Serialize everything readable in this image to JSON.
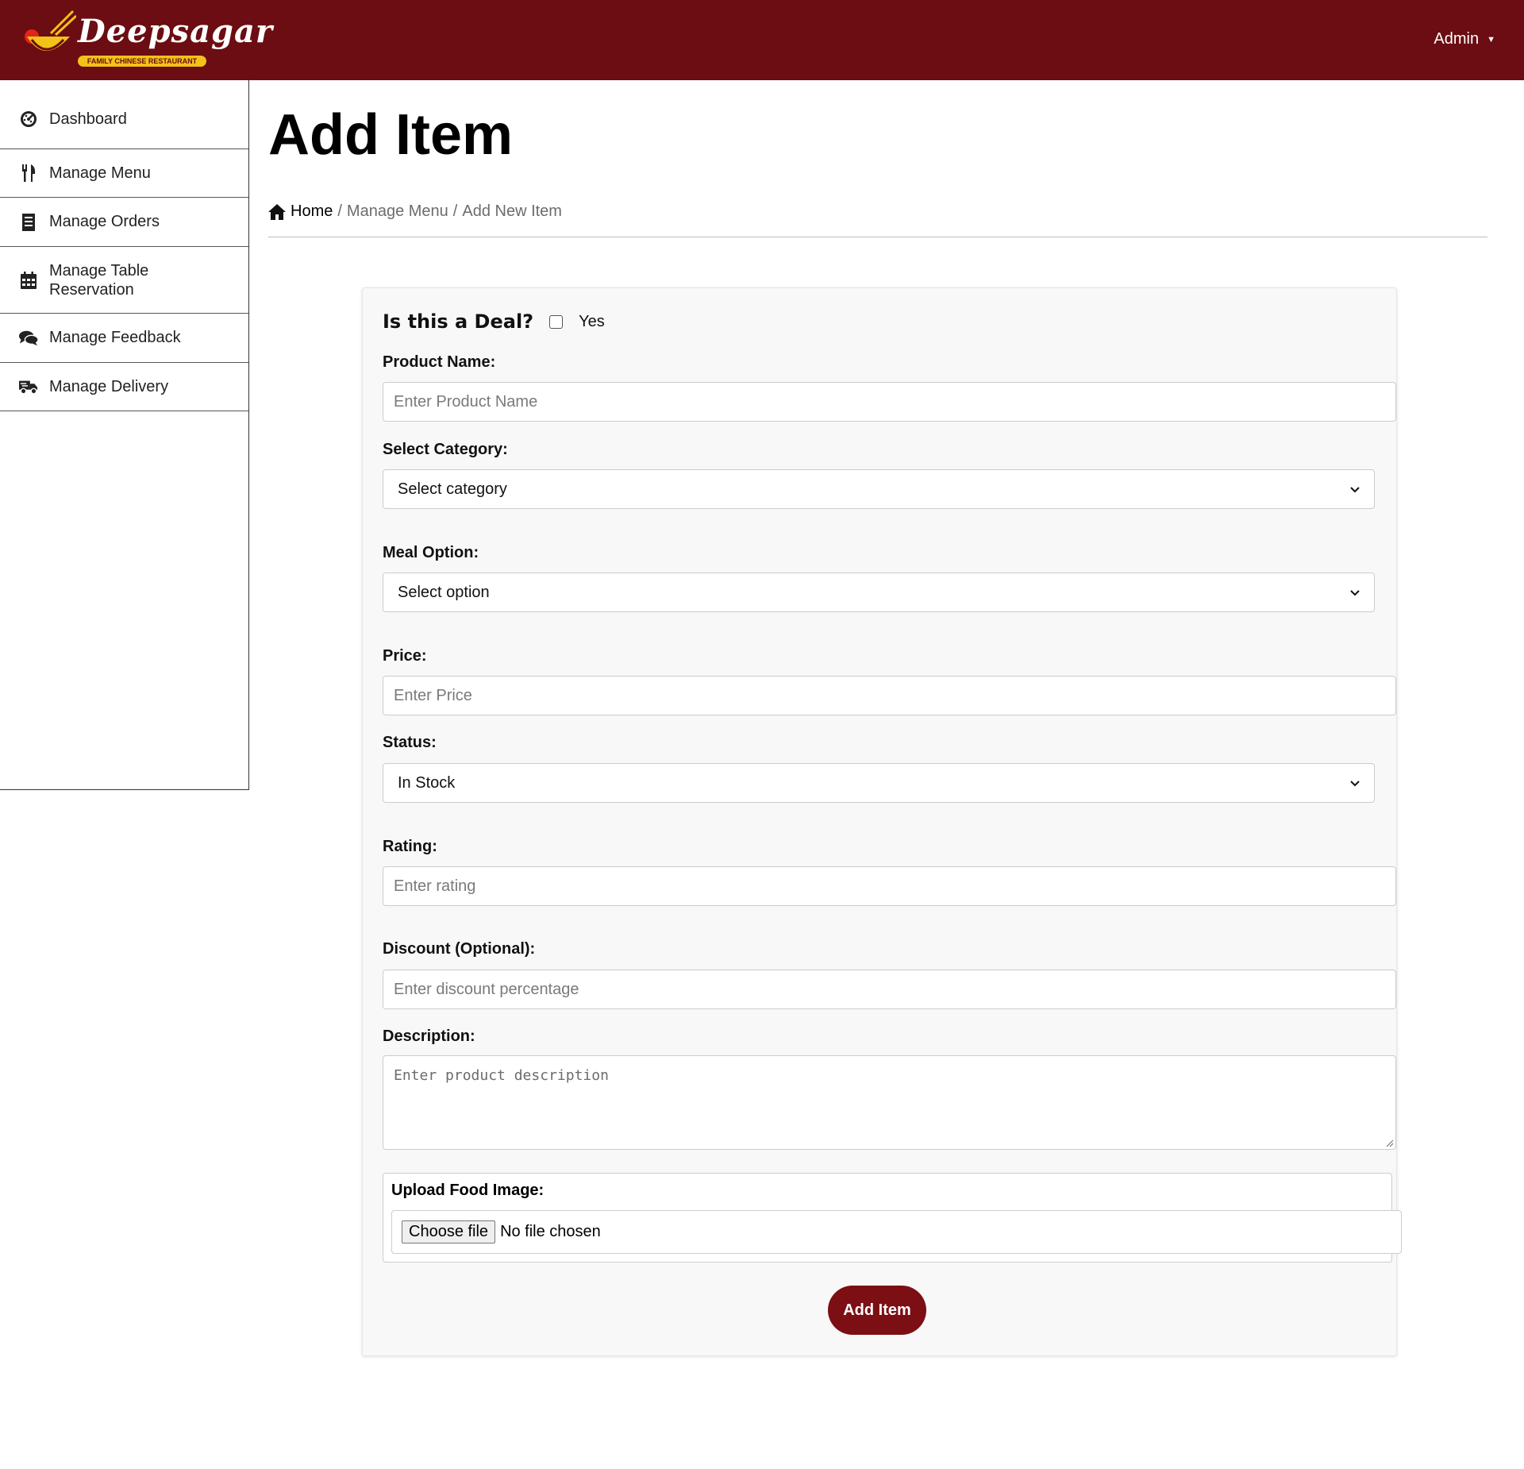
{
  "header": {
    "brand_name": "Deepsagar",
    "brand_tagline": "FAMILY CHINESE RESTAURANT",
    "user_menu_label": "Admin",
    "colors": {
      "topbar": "#6b0d12",
      "accent": "#7c0f14",
      "badge": "#f2c21a"
    }
  },
  "sidebar": {
    "items": [
      {
        "label": "Dashboard",
        "icon": "dashboard-icon"
      },
      {
        "label": "Manage Menu",
        "icon": "utensils-icon"
      },
      {
        "label": "Manage Orders",
        "icon": "receipt-icon"
      },
      {
        "label": "Manage Table Reservation",
        "icon": "calendar-icon"
      },
      {
        "label": "Manage Feedback",
        "icon": "comments-icon"
      },
      {
        "label": "Manage Delivery",
        "icon": "truck-icon"
      }
    ]
  },
  "page": {
    "title": "Add Item",
    "breadcrumb": {
      "home": "Home",
      "section": "Manage Menu",
      "current": "Add New Item",
      "separator": "/"
    }
  },
  "form": {
    "deal_question": "Is this a Deal?",
    "deal_option": "Yes",
    "deal_checked": false,
    "product_name": {
      "label": "Product Name:",
      "placeholder": "Enter Product Name",
      "value": ""
    },
    "category": {
      "label": "Select Category:",
      "selected": "Select category"
    },
    "meal_option": {
      "label": "Meal Option:",
      "selected": "Select option"
    },
    "price": {
      "label": "Price:",
      "placeholder": "Enter Price",
      "value": ""
    },
    "status": {
      "label": "Status:",
      "selected": "In Stock"
    },
    "rating": {
      "label": "Rating:",
      "placeholder": "Enter rating",
      "value": ""
    },
    "discount": {
      "label": "Discount (Optional):",
      "placeholder": "Enter discount percentage",
      "value": ""
    },
    "description": {
      "label": "Description:",
      "placeholder": "Enter product description",
      "value": ""
    },
    "upload": {
      "label": "Upload Food Image:",
      "button_label": "Choose file",
      "status": "No file chosen"
    },
    "submit_label": "Add Item"
  }
}
